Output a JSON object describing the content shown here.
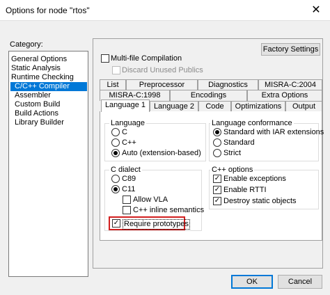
{
  "window": {
    "title": "Options for node \"rtos\"",
    "close_glyph": "✕"
  },
  "category": {
    "label": "Category:",
    "items": [
      {
        "label": "General Options"
      },
      {
        "label": "Static Analysis"
      },
      {
        "label": "Runtime Checking"
      },
      {
        "label": "C/C++ Compiler",
        "selected": true
      },
      {
        "label": "Assembler"
      },
      {
        "label": "Custom Build"
      },
      {
        "label": "Build Actions"
      },
      {
        "label": "Library Builder"
      }
    ]
  },
  "top": {
    "factory_settings": "Factory Settings",
    "multifile": {
      "label": "Multi-file Compilation",
      "checked": false
    },
    "discard": {
      "label": "Discard Unused Publics",
      "checked": false,
      "enabled": false
    }
  },
  "tabs": {
    "row1": [
      "List",
      "Preprocessor",
      "Diagnostics",
      "MISRA-C:2004"
    ],
    "row2": [
      "MISRA-C:1998",
      "Encodings",
      "Extra Options"
    ],
    "row3": [
      "Language 1",
      "Language 2",
      "Code",
      "Optimizations",
      "Output"
    ],
    "active": "Language 1"
  },
  "language": {
    "title": "Language",
    "options": [
      "C",
      "C++",
      "Auto (extension-based)"
    ],
    "selected": "Auto (extension-based)"
  },
  "conformance": {
    "title": "Language conformance",
    "options": [
      "Standard with IAR extensions",
      "Standard",
      "Strict"
    ],
    "selected": "Standard with IAR extensions"
  },
  "c_dialect": {
    "title": "C dialect",
    "options": [
      "C89",
      "C11"
    ],
    "selected": "C11",
    "allow_vla": {
      "label": "Allow VLA",
      "checked": false
    },
    "cpp_inline": {
      "label": "C++ inline semantics",
      "checked": false
    },
    "require_prototypes": {
      "label": "Require prototypes",
      "checked": true
    }
  },
  "cpp_options": {
    "title": "C++ options",
    "items": [
      {
        "label": "Enable exceptions",
        "checked": true
      },
      {
        "label": "Enable RTTI",
        "checked": true
      },
      {
        "label": "Destroy static objects",
        "checked": true
      }
    ]
  },
  "footer": {
    "ok": "OK",
    "cancel": "Cancel"
  },
  "colors": {
    "selection": "#0078d7",
    "highlight": "#d21f1f"
  }
}
